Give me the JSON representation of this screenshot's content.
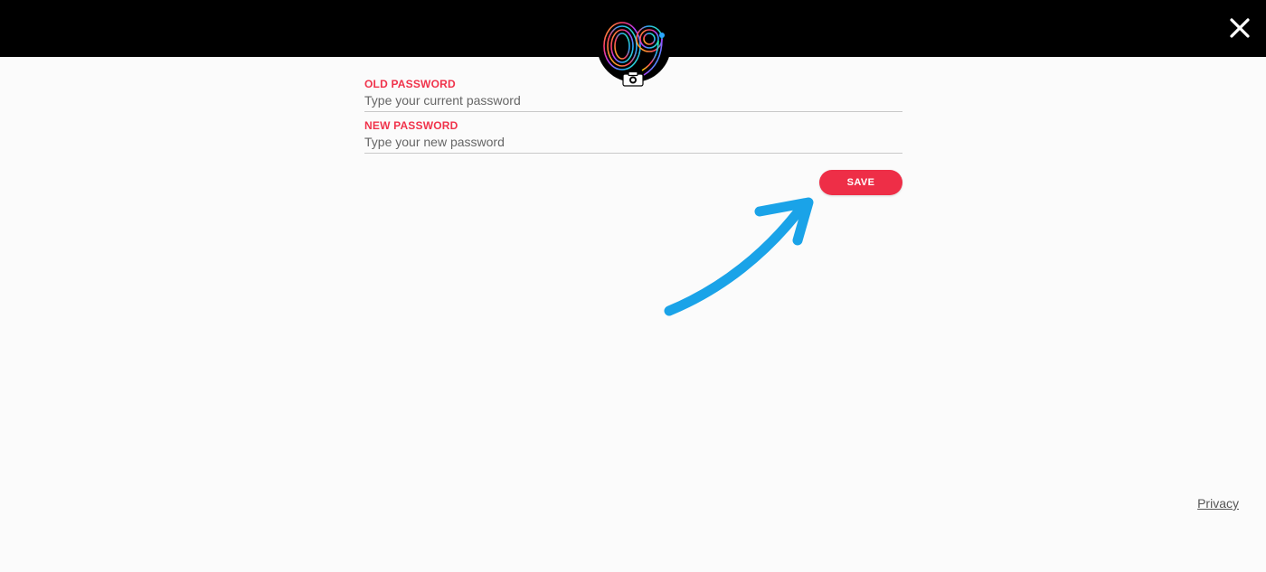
{
  "header": {
    "close_icon": "close-icon"
  },
  "avatar": {
    "logo_text": "09",
    "camera_icon": "camera-icon"
  },
  "form": {
    "old_password": {
      "label": "OLD PASSWORD",
      "placeholder": "Type your current password",
      "value": ""
    },
    "new_password": {
      "label": "NEW PASSWORD",
      "placeholder": "Type your new password",
      "value": ""
    },
    "save_label": "SAVE"
  },
  "annotation": {
    "arrow_icon": "curved-arrow-icon",
    "arrow_color": "#1aa3e8"
  },
  "footer": {
    "privacy_label": "Privacy"
  },
  "colors": {
    "accent": "#ee2e47",
    "label": "#f0334b",
    "topbar": "#000000",
    "background": "#fbfbfb"
  }
}
